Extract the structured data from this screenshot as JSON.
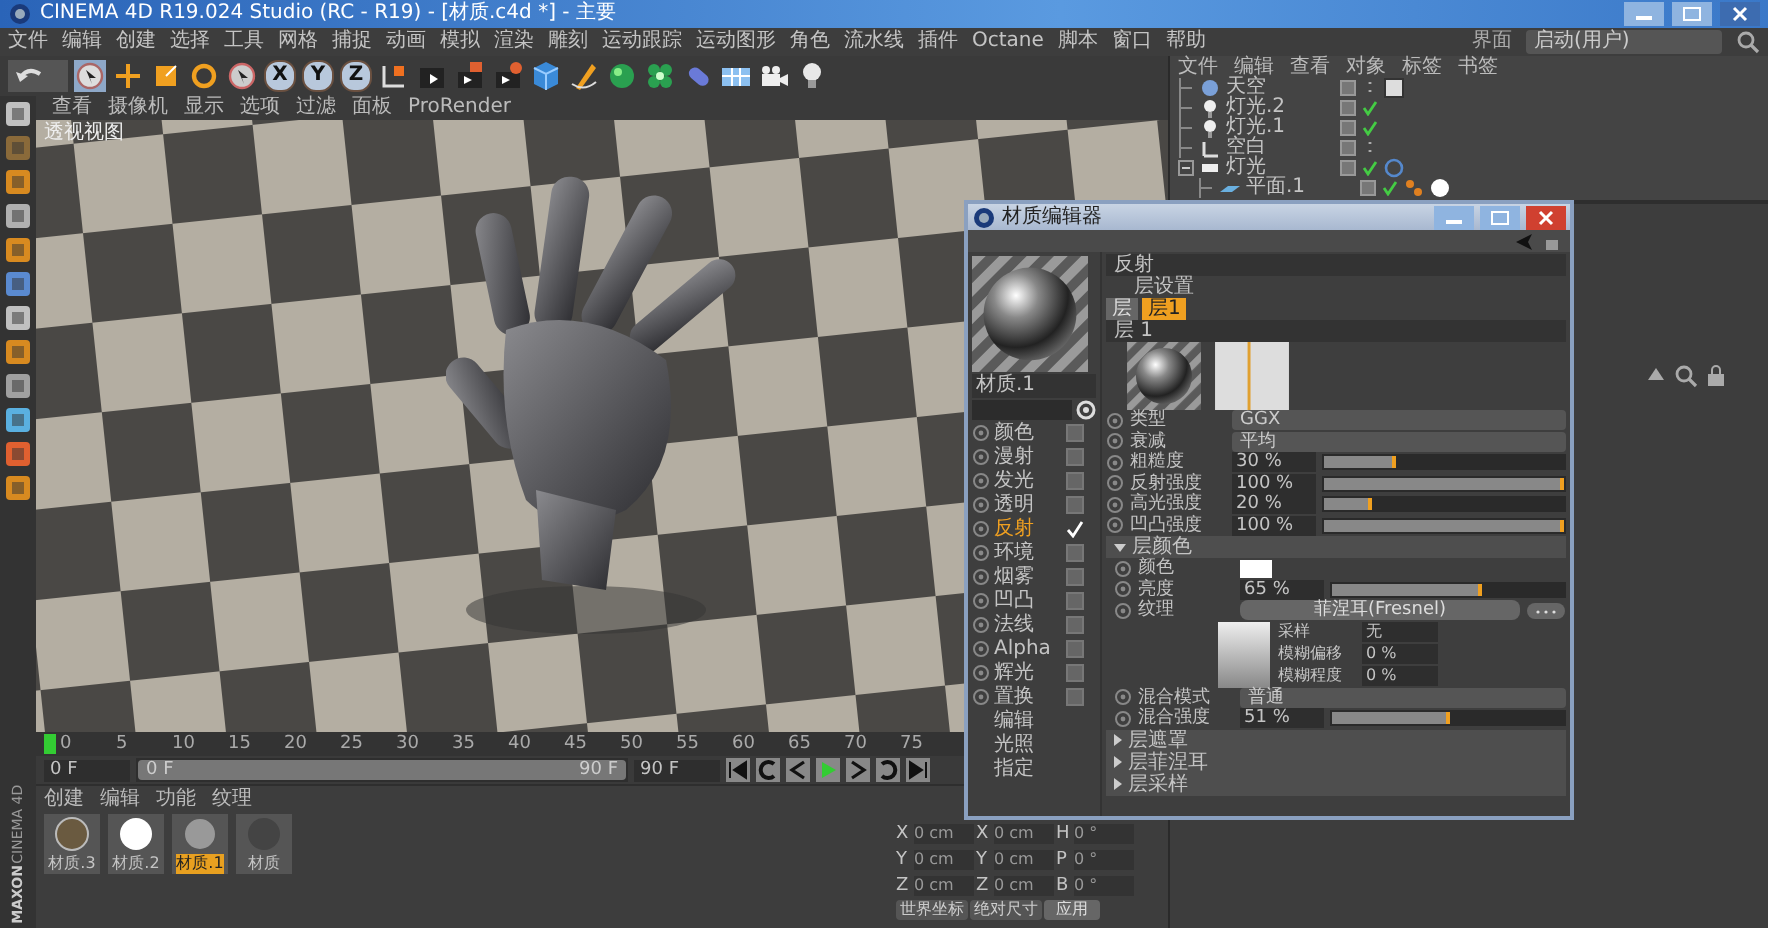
{
  "window": {
    "title": "CINEMA 4D R19.024 Studio (RC - R19) - [材质.c4d *] - 主要"
  },
  "menu": [
    "文件",
    "编辑",
    "创建",
    "选择",
    "工具",
    "网格",
    "捕捉",
    "动画",
    "模拟",
    "渲染",
    "雕刻",
    "运动跟踪",
    "运动图形",
    "角色",
    "流水线",
    "插件",
    "Octane",
    "脚本",
    "窗口",
    "帮助"
  ],
  "layout": {
    "label": "界面",
    "value": "启动(用户)"
  },
  "toolbar": {
    "axes": [
      "X",
      "Y",
      "Z"
    ]
  },
  "logo": {
    "line_1": "MAXON",
    "line_2": "CINEMA 4D"
  },
  "viewport": {
    "menu": [
      "查看",
      "摄像机",
      "显示",
      "选项",
      "过滤",
      "面板",
      "ProRender"
    ],
    "title": "透视视图"
  },
  "timeline": {
    "ticks": [
      "0",
      "5",
      "10",
      "15",
      "20",
      "25",
      "30",
      "35",
      "40",
      "45",
      "50",
      "55",
      "60",
      "65",
      "70",
      "75"
    ],
    "start": "0 F",
    "range": {
      "start": "0 F",
      "end": "90 F",
      "level": 1.0
    },
    "end": "90 F"
  },
  "material_manager": {
    "tabs": [
      "创建",
      "编辑",
      "功能",
      "纹理"
    ],
    "materials": [
      {
        "name": "材质.3",
        "kind": "scene",
        "selected": false
      },
      {
        "name": "材质.2",
        "kind": "white",
        "selected": false
      },
      {
        "name": "材质.1",
        "kind": "chrome",
        "selected": true
      },
      {
        "name": "材质",
        "kind": "dark",
        "selected": false
      }
    ]
  },
  "coordinates": {
    "rows": [
      {
        "axis": "X",
        "position": "0 cm",
        "size_axis": "X",
        "size": "0 cm",
        "rot_axis": "H",
        "rotation": "0 °"
      },
      {
        "axis": "Y",
        "position": "0 cm",
        "size_axis": "Y",
        "size": "0 cm",
        "rot_axis": "P",
        "rotation": "0 °"
      },
      {
        "axis": "Z",
        "position": "0 cm",
        "size_axis": "Z",
        "size": "0 cm",
        "rot_axis": "B",
        "rotation": "0 °"
      }
    ],
    "mode": "世界坐标",
    "size_mode": "绝对尺寸",
    "apply": "应用"
  },
  "object_manager": {
    "tabs": [
      "文件",
      "编辑",
      "查看",
      "对象",
      "标签",
      "书签"
    ],
    "objects": [
      {
        "name": "天空",
        "kind": "sky",
        "enabled": false,
        "expanded": false,
        "tags": [
          {
            "kind": "texture"
          }
        ]
      },
      {
        "name": "灯光.2",
        "kind": "light",
        "enabled": true,
        "expanded": false
      },
      {
        "name": "灯光.1",
        "kind": "light",
        "enabled": true,
        "expanded": false
      },
      {
        "name": "空白",
        "kind": "null",
        "enabled": false,
        "expanded": false
      },
      {
        "name": "灯光",
        "kind": "area",
        "enabled": true,
        "expanded": true,
        "tags": [
          {
            "kind": "target"
          }
        ],
        "children": [
          {
            "name": "平面.1",
            "kind": "plane",
            "enabled": true,
            "expanded": false,
            "tags": [
              {
                "kind": "dots"
              },
              {
                "kind": "material"
              }
            ]
          }
        ]
      }
    ]
  },
  "material_editor": {
    "title": "材质编辑器",
    "material_name": "材质.1",
    "channels": [
      {
        "label": "颜色",
        "kind": "channel",
        "checked": false,
        "selected": false
      },
      {
        "label": "漫射",
        "kind": "channel",
        "checked": false,
        "selected": false
      },
      {
        "label": "发光",
        "kind": "channel",
        "checked": false,
        "selected": false
      },
      {
        "label": "透明",
        "kind": "channel",
        "checked": false,
        "selected": false
      },
      {
        "label": "反射",
        "kind": "channel",
        "checked": true,
        "selected": true
      },
      {
        "label": "环境",
        "kind": "channel",
        "checked": false,
        "selected": false
      },
      {
        "label": "烟雾",
        "kind": "channel",
        "checked": false,
        "selected": false
      },
      {
        "label": "凹凸",
        "kind": "channel",
        "checked": false,
        "selected": false
      },
      {
        "label": "法线",
        "kind": "channel",
        "checked": false,
        "selected": false
      },
      {
        "label": "Alpha",
        "kind": "channel",
        "checked": false,
        "selected": false
      },
      {
        "label": "辉光",
        "kind": "channel",
        "checked": false,
        "selected": false
      },
      {
        "label": "置换",
        "kind": "channel",
        "checked": false,
        "selected": false
      },
      {
        "label": "编辑",
        "kind": "page",
        "selected": false
      },
      {
        "label": "光照",
        "kind": "page",
        "selected": false
      },
      {
        "label": "指定",
        "kind": "page",
        "selected": false
      }
    ],
    "section": "反射",
    "layer_settings": "层设置",
    "layers": [
      {
        "label": "层",
        "selected": false
      },
      {
        "label": "层1",
        "selected": true
      }
    ],
    "layer_header": "层 1",
    "props": [
      {
        "kind": "dropdown",
        "label": "类型",
        "value": "GGX"
      },
      {
        "kind": "dropdown",
        "label": "衰减",
        "value": "平均"
      },
      {
        "kind": "slider",
        "label": "粗糙度",
        "value": "30 %",
        "level": 0.3
      },
      {
        "kind": "slider",
        "label": "反射强度",
        "value": "100 %",
        "level": 1.0
      },
      {
        "kind": "slider",
        "label": "高光强度",
        "value": "20 %",
        "level": 0.2
      },
      {
        "kind": "slider",
        "label": "凹凸强度",
        "value": "100 %",
        "level": 1.0
      }
    ],
    "sections": [
      {
        "title": "层颜色",
        "expanded": true,
        "props": [
          {
            "kind": "color",
            "label": "颜色"
          },
          {
            "kind": "slider",
            "label": "亮度",
            "value": "65 %",
            "level": 0.65
          },
          {
            "kind": "texture",
            "label": "纹理",
            "value": "菲涅耳(Fresnel)",
            "fields": [
              {
                "label": "采样",
                "value": "无"
              },
              {
                "label": "模糊偏移",
                "value": "0 %"
              },
              {
                "label": "模糊程度",
                "value": "0 %"
              }
            ]
          },
          {
            "kind": "dropdown",
            "label": "混合模式",
            "value": "普通"
          },
          {
            "kind": "slider",
            "label": "混合强度",
            "value": "51 %",
            "level": 0.51
          }
        ]
      },
      {
        "title": "层遮罩",
        "expanded": false
      },
      {
        "title": "层菲涅耳",
        "expanded": false
      },
      {
        "title": "层采样",
        "expanded": false
      }
    ]
  }
}
